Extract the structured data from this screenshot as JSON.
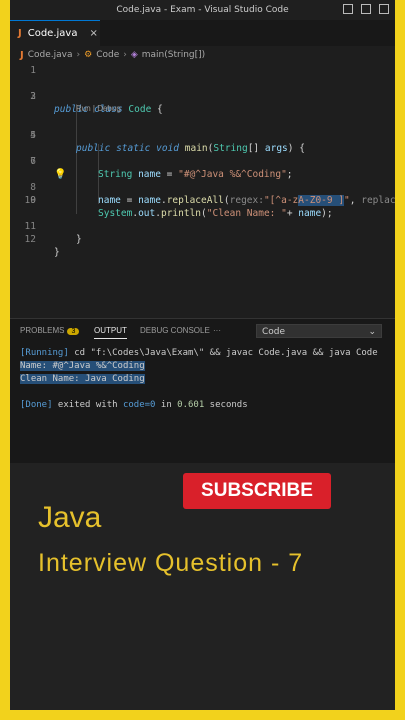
{
  "window": {
    "title": "Code.java - Exam - Visual Studio Code"
  },
  "tab": {
    "icon": "J",
    "label": "Code.java",
    "close": "×"
  },
  "breadcrumb": {
    "file": "Code.java",
    "class": "Code",
    "method": "main(String[])"
  },
  "codelens": "Run | Debug",
  "lines": [
    {
      "n": "1"
    },
    {
      "n": "2"
    },
    {
      "n": "3"
    },
    {
      "n": "4"
    },
    {
      "n": "5"
    },
    {
      "n": "6"
    },
    {
      "n": "7"
    },
    {
      "n": "8"
    },
    {
      "n": "9"
    },
    {
      "n": "10"
    },
    {
      "n": "11"
    },
    {
      "n": "12"
    }
  ],
  "code": {
    "l2": {
      "kw1": "public",
      "kw2": "class",
      "name": "Code",
      "brace": " {"
    },
    "l4": {
      "kw1": "public",
      "kw2": "static",
      "kw3": "void",
      "fn": "main",
      "p1": "(",
      "type": "String",
      "p2": "[] ",
      "var": "args",
      "p3": ") {"
    },
    "l6": {
      "type": "String",
      "var": "name",
      "eq": " = ",
      "str": "\"#@^Java %&^Coding\"",
      "end": ";"
    },
    "l8": {
      "var1": "name",
      "eq": " = ",
      "var2": "name",
      "dot": ".",
      "fn": "replaceAll",
      "p": "(",
      "hint": "regex:",
      "str_a": "\"[^a-z",
      "str_sel": "A-Z0-9 ]",
      "str_b": "\"",
      "comma": ", ",
      "hint2": "replacem"
    },
    "l9": {
      "type": "System",
      "dot1": ".",
      "var": "out",
      "dot2": ".",
      "fn": "println",
      "p": "(",
      "str": "\"Clean Name: \"",
      "plus": "+ ",
      "var2": "name",
      "end": ");"
    },
    "l11": "}",
    "l12": "}"
  },
  "panel": {
    "tabs": [
      "PROBLEMS",
      "OUTPUT",
      "DEBUG CONSOLE",
      "···"
    ],
    "problems_count": "3",
    "dropdown": "Code"
  },
  "output": {
    "running_tag": "[Running]",
    "running_cmd": " cd \"f:\\Codes\\Java\\Exam\\\" && javac Code.java && java Code",
    "line2": "Name: #@^Java %&^Coding",
    "line3": "Clean Name: Java Coding",
    "done_tag": "[Done]",
    "done_a": " exited with ",
    "done_code": "code=0",
    "done_b": " in ",
    "done_time": "0.601",
    "done_c": " seconds"
  },
  "promo": {
    "subscribe": "SUBSCRIBE",
    "title": "Java",
    "subtitle": "Interview Question - 7"
  }
}
